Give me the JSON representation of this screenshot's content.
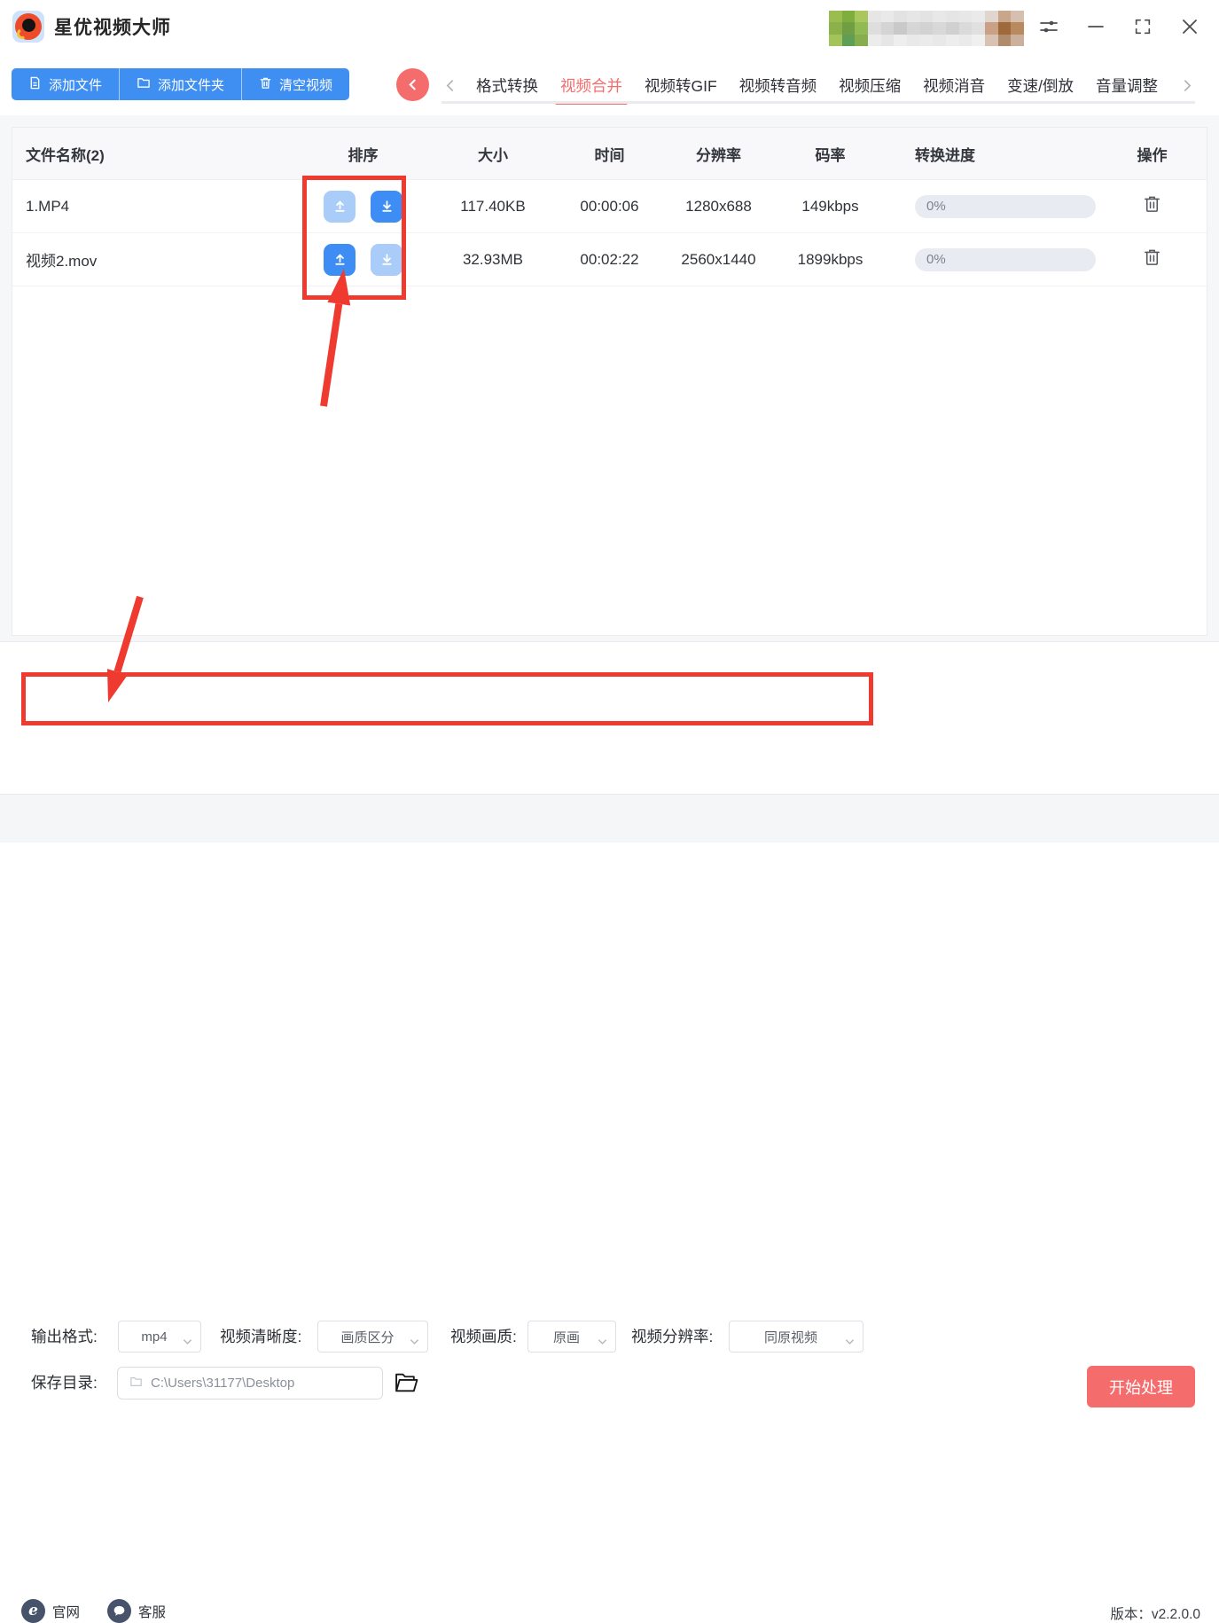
{
  "app": {
    "title": "星优视频大师"
  },
  "user_blur": {
    "colors": [
      [
        "#9bbc4e",
        "#7fae3f",
        "#a9c75d",
        "#e6e6e6",
        "#e9e9e9",
        "#e2e2e2",
        "#e6e6e6",
        "#e3e3e3",
        "#e8e8e8",
        "#e5e5e5",
        "#e7e7e7",
        "#eaeaea",
        "#e0d6ce",
        "#c9a589",
        "#d6bfae"
      ],
      [
        "#8cb14a",
        "#6f9e44",
        "#91b954",
        "#dedede",
        "#d4d4d4",
        "#c9c9c9",
        "#d6d6d6",
        "#d2d2d2",
        "#d8d8d8",
        "#d0d0d0",
        "#dadada",
        "#e0e0e0",
        "#caa184",
        "#9e6a3c",
        "#b98a5e"
      ],
      [
        "#a3c45b",
        "#5f9e55",
        "#86ad4e",
        "#ececec",
        "#e6e6e6",
        "#eeeeee",
        "#e9e9e9",
        "#ebebeb",
        "#e8e8e8",
        "#ededed",
        "#eaeaea",
        "#f0f0f0",
        "#d8c2b2",
        "#b08c6d",
        "#cbb09c"
      ]
    ]
  },
  "toolbar": {
    "add_file": "添加文件",
    "add_folder": "添加文件夹",
    "clear": "清空视频"
  },
  "tabs": {
    "items": [
      "格式转换",
      "视频合并",
      "视频转GIF",
      "视频转音频",
      "视频压缩",
      "视频消音",
      "变速/倒放",
      "音量调整"
    ],
    "active": "视频合并"
  },
  "table": {
    "headers": [
      "文件名称(2)",
      "排序",
      "大小",
      "时间",
      "分辨率",
      "码率",
      "转换进度",
      "操作"
    ],
    "rows": [
      {
        "name": "1.MP4",
        "size": "117.40KB",
        "time": "00:00:06",
        "resolution": "1280x688",
        "bitrate": "149kbps",
        "progress": "0%",
        "up_enabled": false,
        "down_enabled": true
      },
      {
        "name": "视频2.mov",
        "size": "32.93MB",
        "time": "00:02:22",
        "resolution": "2560x1440",
        "bitrate": "1899kbps",
        "progress": "0%",
        "up_enabled": true,
        "down_enabled": false
      }
    ]
  },
  "settings": {
    "output_format_label": "输出格式:",
    "output_format_value": "mp4",
    "clarity_label": "视频清晰度:",
    "clarity_value": "画质区分",
    "quality_label": "视频画质:",
    "quality_value": "原画",
    "resolution_label": "视频分辨率:",
    "resolution_value": "同原视频",
    "save_dir_label": "保存目录:",
    "save_dir_value": "C:\\Users\\31177\\Desktop",
    "start_button": "开始处理"
  },
  "footer": {
    "website": "官网",
    "support": "客服",
    "version": "版本：v2.2.0.0"
  },
  "colors": {
    "primary_blue": "#3f8ff2",
    "accent_red": "#f56c6c",
    "annotation_red": "#ef3a30",
    "disabled_blue": "#a9cdf8"
  }
}
